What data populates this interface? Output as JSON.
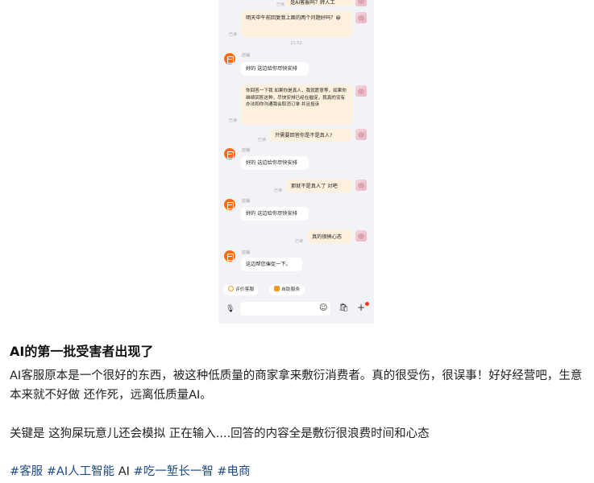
{
  "chat": {
    "messages": [
      {
        "side": "user",
        "text": "是AI客服吗？转人工",
        "read": "已读"
      },
      {
        "side": "user",
        "text": "明天中午前回复我上面的两个问题好吗？😀",
        "read": "已读"
      },
      {
        "side": "time",
        "text": "21:52"
      },
      {
        "side": "shop",
        "name": "店铺",
        "text": "好的 这边给你尽快安排"
      },
      {
        "side": "user",
        "text": "你回答一下我 如果你是真人，我就愿意等，如果你继续回答这种，尽快安排已经在催促，我真的没有办法和你沟通我会取消订单 并且投诉",
        "read": "已读"
      },
      {
        "side": "user",
        "text": "只需要回答你是不是真人?",
        "read": "已读"
      },
      {
        "side": "shop",
        "name": "店铺",
        "text": "好的 这边给你尽快安排"
      },
      {
        "side": "user",
        "text": "那就不是真人了 对吧",
        "read": "已读"
      },
      {
        "side": "shop",
        "name": "店铺",
        "text": "好的 这边给你尽快安排"
      },
      {
        "side": "user",
        "text": "真的很搞心态",
        "read": "已读"
      },
      {
        "side": "shop",
        "name": "店铺",
        "text": "这边帮您催促一下。"
      }
    ],
    "quick_actions": {
      "rate": "评价客服",
      "self_service": "自助服务"
    },
    "input_bar": {
      "mic_icon": "microphone-icon",
      "emoji_icon": "smile-icon",
      "bag_icon": "shopping-bag-icon",
      "plus_icon": "plus-icon"
    }
  },
  "post": {
    "title": "AI的第一批受害者出现了",
    "paragraph1": "AI客服原本是一个很好的东西，被这种低质量的商家拿来敷衍消费者。真的很受伤，很误事！好好经营吧，生意本来就不好做 还作死，远离低质量AI。",
    "paragraph2": "关键是 这狗屎玩意儿还会模拟 正在输入....回答的内容全是敷衍很浪费时间和心态",
    "tags": [
      "#客服",
      "#AI人工智能",
      "AI",
      "#吃一堑长一智",
      "#电商"
    ]
  },
  "colors": {
    "user_bubble": "#fdf0dc",
    "shop_avatar": "#ff6a13",
    "tag": "#1f4a88",
    "chat_bg": "#f2f3f7"
  }
}
